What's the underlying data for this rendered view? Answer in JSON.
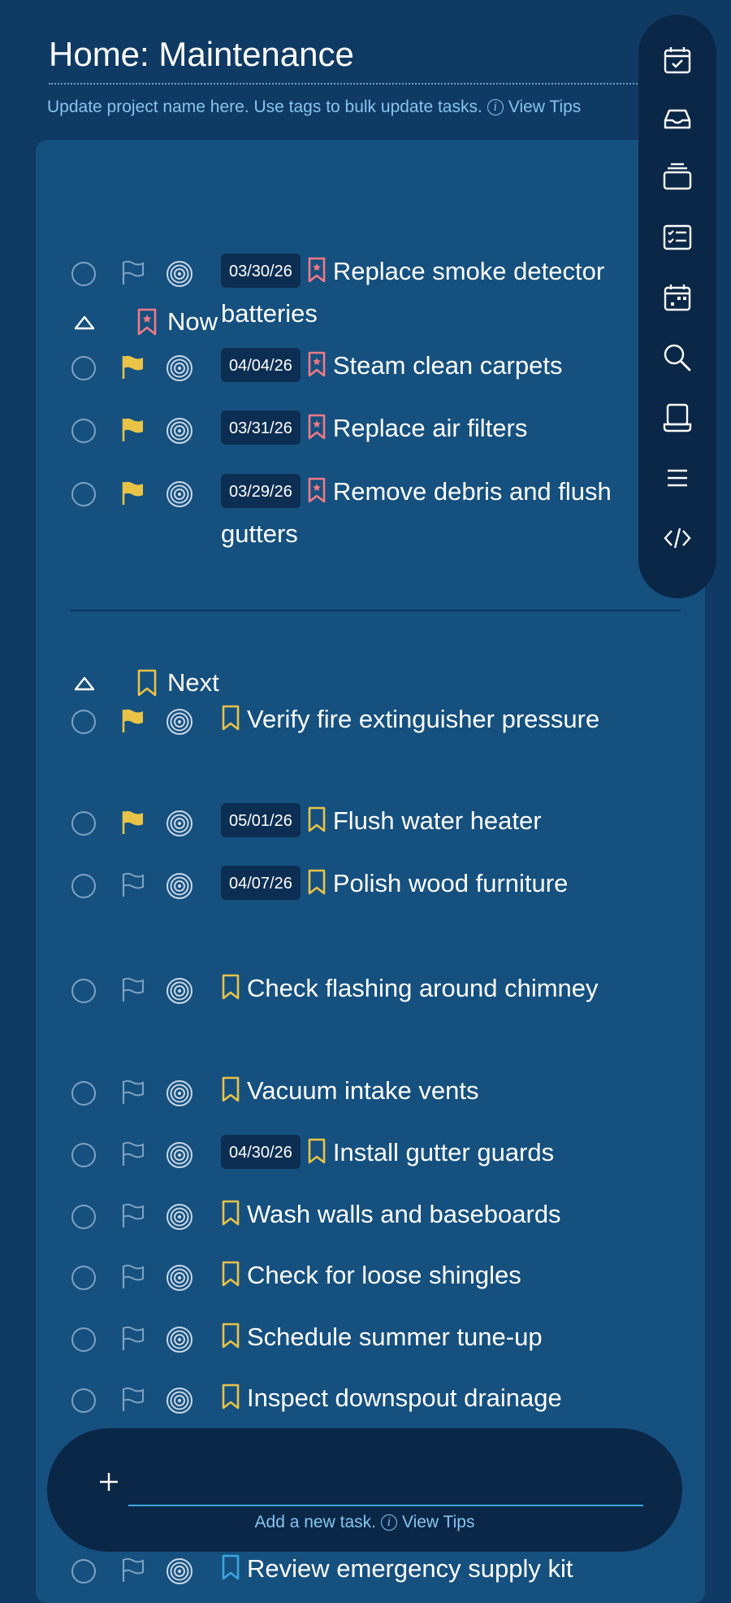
{
  "header": {
    "title": "Home: Maintenance",
    "hint": "Update project name here. Use tags to bulk update tasks.",
    "view_tips": "View Tips"
  },
  "colors": {
    "background": "#0f3a63",
    "panel": "#15507f",
    "rail": "#0b2747",
    "now_accent": "#f07a86",
    "next_accent": "#e9c347",
    "link": "#86c5f0",
    "input_underline": "#3ba7df"
  },
  "sections": [
    {
      "label": "Now",
      "icon": "bookmark-star-icon",
      "tasks": [
        {
          "date": "03/30/26",
          "title": "Replace smoke detector batteries",
          "flagged": false
        },
        {
          "date": "04/04/26",
          "title": "Steam clean carpets",
          "flagged": true
        },
        {
          "date": "03/31/26",
          "title": "Replace air filters",
          "flagged": true
        },
        {
          "date": "03/29/26",
          "title": "Remove debris and flush gutters",
          "flagged": true
        }
      ]
    },
    {
      "label": "Next",
      "icon": "bookmark-icon",
      "tasks": [
        {
          "date": "",
          "title": "Verify fire extinguisher pressure",
          "flagged": true
        },
        {
          "date": "05/01/26",
          "title": "Flush water heater",
          "flagged": true
        },
        {
          "date": "04/07/26",
          "title": "Polish wood furniture",
          "flagged": false
        },
        {
          "date": "",
          "title": "Check flashing around chimney",
          "flagged": false
        },
        {
          "date": "",
          "title": "Vacuum intake vents",
          "flagged": false
        },
        {
          "date": "04/30/26",
          "title": "Install gutter guards",
          "flagged": false
        },
        {
          "date": "",
          "title": "Wash walls and baseboards",
          "flagged": false
        },
        {
          "date": "",
          "title": "Check for loose shingles",
          "flagged": false
        },
        {
          "date": "",
          "title": "Schedule summer tune-up",
          "flagged": false
        },
        {
          "date": "",
          "title": "Inspect downspout drainage",
          "flagged": false
        }
      ]
    },
    {
      "label": "",
      "tasks": [
        {
          "date": "",
          "title": "Review emergency supply kit",
          "flagged": false
        }
      ]
    }
  ],
  "side_rail": [
    "calendar-check-icon",
    "inbox-icon",
    "stack-icon",
    "checklist-icon",
    "calendar-icon",
    "search-icon",
    "device-icon",
    "menu-icon",
    "code-icon"
  ],
  "add_task": {
    "placeholder": "",
    "hint": "Add a new task.",
    "view_tips": "View Tips"
  }
}
